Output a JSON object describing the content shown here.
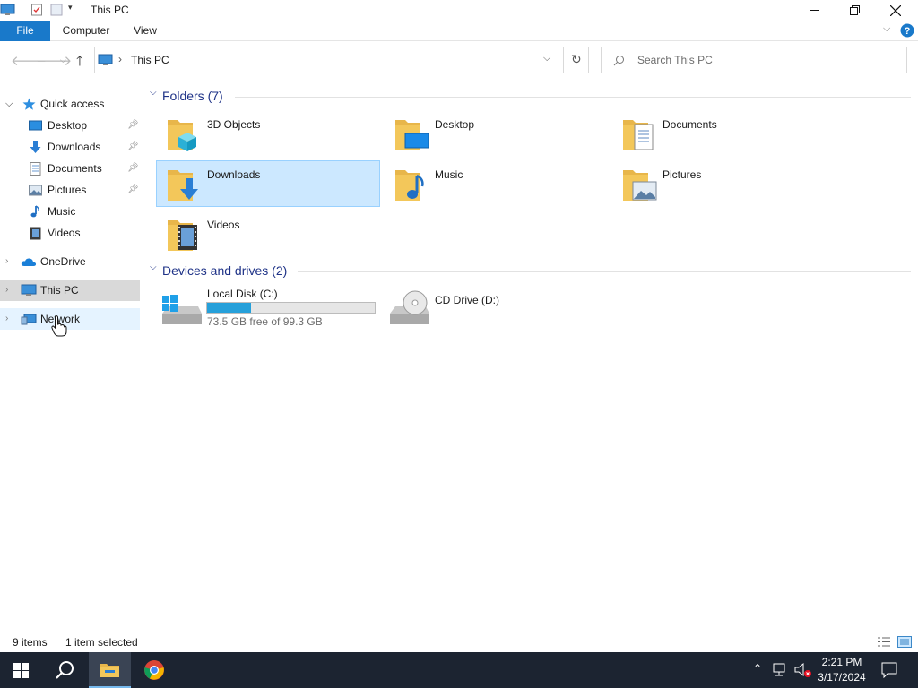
{
  "window": {
    "title": "This PC"
  },
  "ribbon": {
    "tabs": [
      "File",
      "Computer",
      "View"
    ]
  },
  "address": {
    "location": "This PC",
    "search_placeholder": "Search This PC"
  },
  "nav": {
    "quick_access": "Quick access",
    "pinned": [
      {
        "label": "Desktop",
        "icon": "desktop-icon",
        "pinned": true
      },
      {
        "label": "Downloads",
        "icon": "downloads-icon",
        "pinned": true
      },
      {
        "label": "Documents",
        "icon": "documents-icon",
        "pinned": true
      },
      {
        "label": "Pictures",
        "icon": "pictures-icon",
        "pinned": true
      },
      {
        "label": "Music",
        "icon": "music-icon",
        "pinned": false
      },
      {
        "label": "Videos",
        "icon": "videos-icon",
        "pinned": false
      }
    ],
    "onedrive": "OneDrive",
    "this_pc": "This PC",
    "network": "Network"
  },
  "folders": {
    "header": "Folders (7)",
    "items": [
      {
        "label": "3D Objects",
        "badge": "3d-objects-icon"
      },
      {
        "label": "Desktop",
        "badge": "desktop-icon"
      },
      {
        "label": "Documents",
        "badge": "documents-icon"
      },
      {
        "label": "Downloads",
        "badge": "downloads-icon",
        "selected": true
      },
      {
        "label": "Music",
        "badge": "music-icon"
      },
      {
        "label": "Pictures",
        "badge": "pictures-icon"
      },
      {
        "label": "Videos",
        "badge": "videos-icon"
      }
    ]
  },
  "drives": {
    "header": "Devices and drives (2)",
    "items": [
      {
        "label": "Local Disk (C:)",
        "free_text": "73.5 GB free of 99.3 GB",
        "used_fraction": 0.26
      },
      {
        "label": "CD Drive (D:)"
      }
    ]
  },
  "status": {
    "item_count": "9 items",
    "selection": "1 item selected"
  },
  "taskbar": {
    "time": "2:21 PM",
    "date": "3/17/2024"
  },
  "colors": {
    "accent": "#1979ca",
    "selection": "#cce8ff",
    "folder": "#f3c75a",
    "taskbar": "#1c2431",
    "group_header": "#1e3287"
  }
}
